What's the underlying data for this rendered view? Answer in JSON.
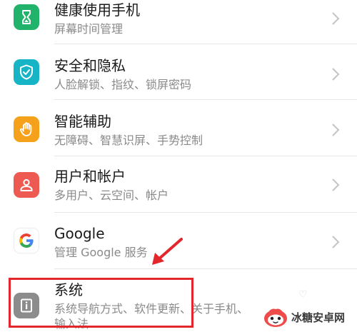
{
  "settings": {
    "items": [
      {
        "title": "健康使用手机",
        "subtitle": "屏幕时间管理",
        "icon": "hourglass-icon",
        "color": "#21b36b"
      },
      {
        "title": "安全和隐私",
        "subtitle": "人脸解锁、指纹、锁屏密码",
        "icon": "shield-check-icon",
        "color": "#17b4c6"
      },
      {
        "title": "智能辅助",
        "subtitle": "无障碍、智慧识屏、手势控制",
        "icon": "hand-icon",
        "color": "#f6a11c"
      },
      {
        "title": "用户和帐户",
        "subtitle": "多用户、云空间、帐户",
        "icon": "user-icon",
        "color": "#ec5a52"
      },
      {
        "title": "Google",
        "subtitle": "管理 Google 服务",
        "icon": "google-icon",
        "color": "#ffffff"
      },
      {
        "title": "系统",
        "subtitle": "系统导航方式、软件更新、关于手机、",
        "subtitle_line2": "输入法",
        "icon": "info-icon",
        "color": "#8c8c8c"
      }
    ]
  },
  "annotation": {
    "highlight_color": "#e3262c"
  },
  "watermark": {
    "text": "冰糖安卓网"
  }
}
